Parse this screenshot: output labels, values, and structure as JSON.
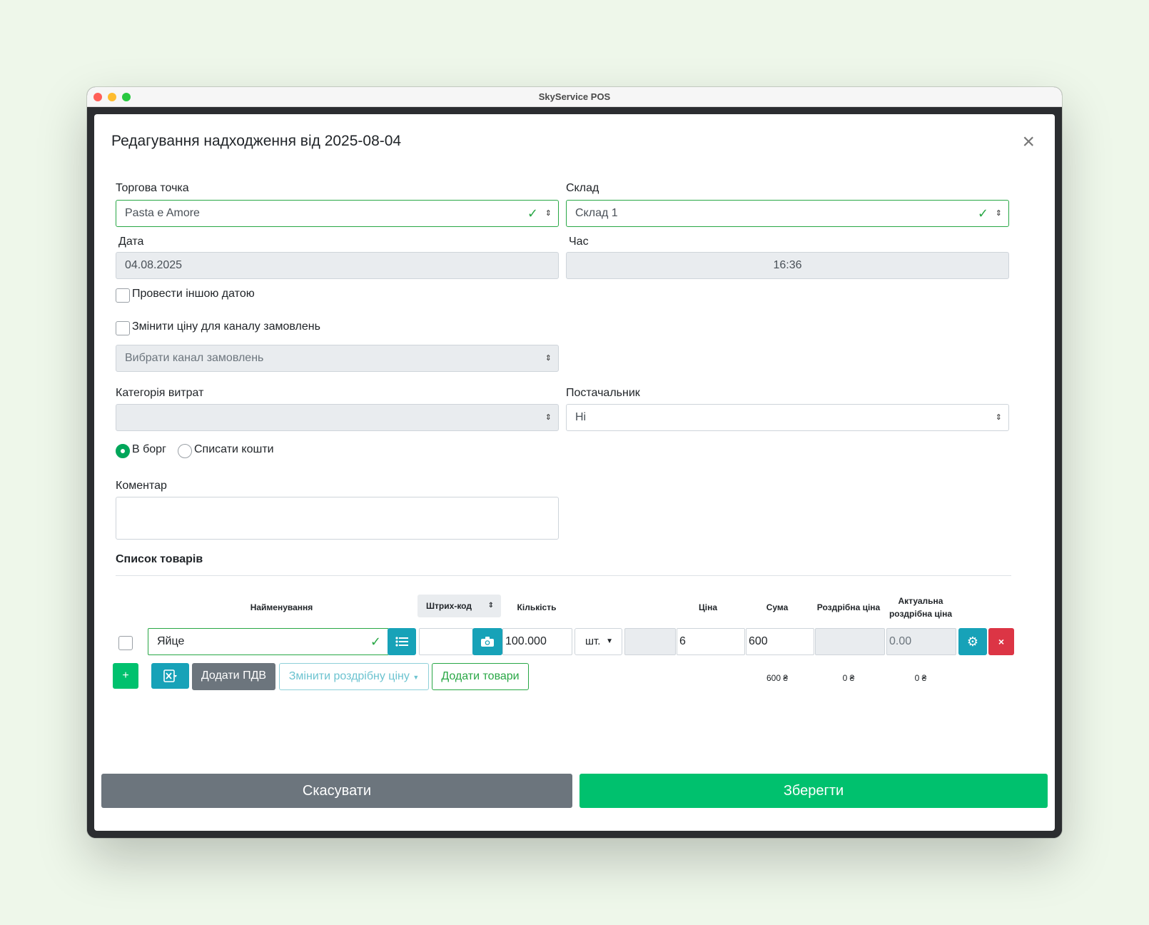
{
  "window": {
    "title": "SkyService POS"
  },
  "modal": {
    "title": "Редагування надходження від 2025-08-04",
    "close_icon": "×"
  },
  "form": {
    "store_label": "Торгова точка",
    "store_value": "Pasta e Amore",
    "warehouse_label": "Склад",
    "warehouse_value": "Склад 1",
    "date_label": "Дата",
    "date_value": "04.08.2025",
    "time_label": "Час",
    "time_value": "16:36",
    "other_date_label": "Провести іншою датою",
    "change_price_label": "Змінити ціну для каналу замовлень",
    "channel_placeholder": "Вибрати канал замовлень",
    "expense_category_label": "Категорія витрат",
    "expense_category_value": "",
    "supplier_label": "Постачальник",
    "supplier_value": "Hi",
    "radio_debt_label": "В борг",
    "radio_writeoff_label": "Списати кошти",
    "comment_label": "Коментар"
  },
  "products": {
    "section_title": "Список товарів",
    "headers": {
      "name": "Найменування",
      "barcode": "Штрих-код",
      "quantity": "Кількість",
      "price": "Ціна",
      "sum": "Сума",
      "retail": "Роздрібна ціна",
      "actual_retail": "Актуальна роздрібна ціна"
    },
    "rows": [
      {
        "name": "Яйце",
        "barcode": "",
        "quantity": "100.000",
        "unit": "шт.",
        "price": "6",
        "sum": "600",
        "retail": "",
        "actual_retail": "0.00"
      }
    ],
    "actions": {
      "add_vat": "Додати ПДВ",
      "change_retail": "Змінити роздрібну ціну",
      "add_products": "Додати товари"
    },
    "totals": {
      "sum": "600 ₴",
      "retail": "0 ₴",
      "actual_retail": "0 ₴"
    }
  },
  "footer": {
    "cancel": "Скасувати",
    "save": "Зберегти"
  },
  "colors": {
    "accent_green": "#00c16e",
    "valid_green": "#28a745",
    "teal": "#17a2b8",
    "danger": "#dc3545",
    "grey": "#6c757d"
  }
}
